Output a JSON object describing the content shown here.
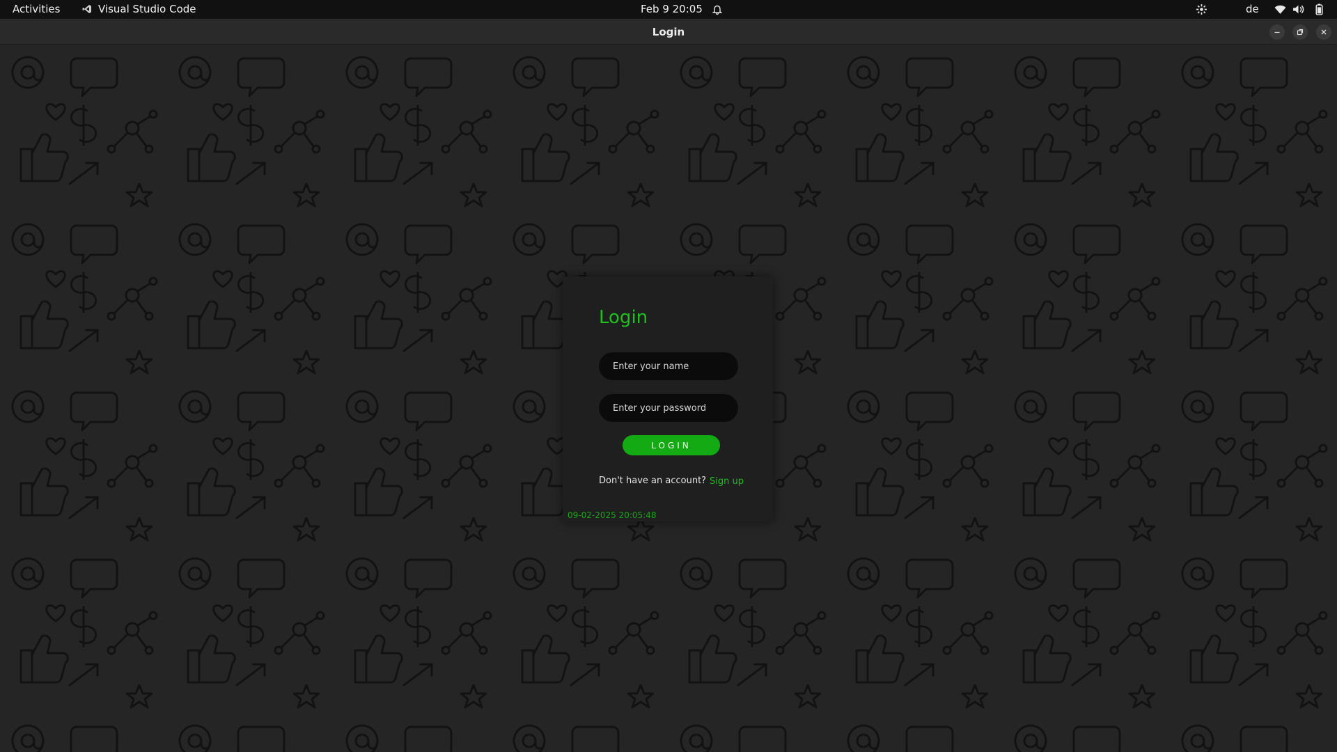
{
  "topbar": {
    "activities": "Activities",
    "app_name": "Visual Studio Code",
    "clock": "Feb 9  20:05",
    "keyboard_layout": "de",
    "icons": [
      "vscode-icon",
      "alarm-icon",
      "accessibility-icon",
      "wifi-icon",
      "volume-icon",
      "battery-icon"
    ]
  },
  "window": {
    "title": "Login",
    "controls": [
      "minimize-icon",
      "maximize-icon",
      "close-icon"
    ]
  },
  "login": {
    "heading": "Login",
    "name_placeholder": "Enter your name",
    "password_placeholder": "Enter your password",
    "button_label": "LOGIN",
    "no_account_text": "Don't have an account?",
    "signup_label": "Sign up",
    "timestamp": "09-02-2025 20:05:48"
  },
  "colors": {
    "accent": "#1ec01e",
    "button": "#14aa14",
    "card": "#1f1f1f",
    "field": "#0b0b0b",
    "wallpaper": "#252525",
    "doodle_stroke": "#111111"
  }
}
